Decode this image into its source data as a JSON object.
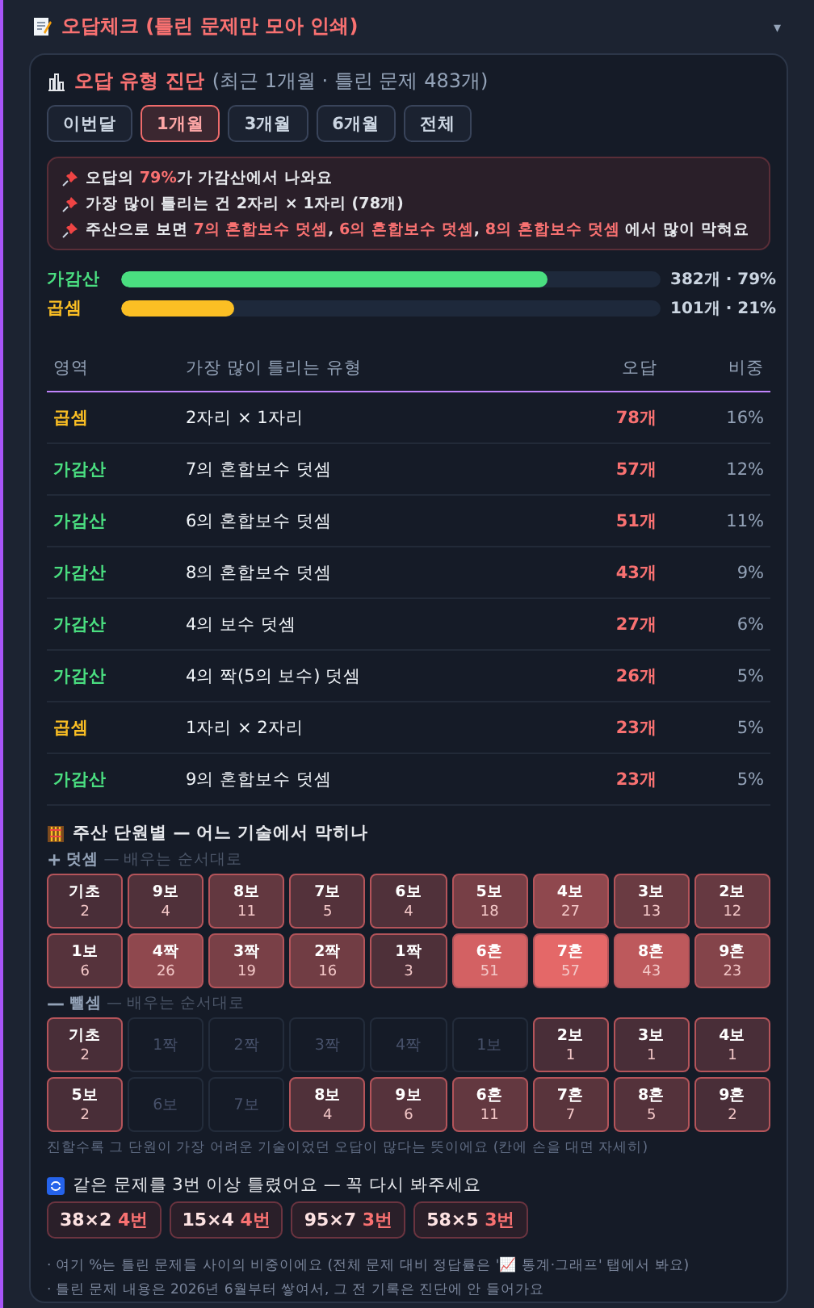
{
  "panel": {
    "title": "오답체크 (틀린 문제만 모아 인쇄)",
    "toggle": "▾"
  },
  "diagnosis": {
    "title": "오답 유형 진단",
    "subtitle": "(최근 1개월 · 틀린 문제 483개)",
    "periods": [
      {
        "label": "이번달",
        "selected": false
      },
      {
        "label": "1개월",
        "selected": true
      },
      {
        "label": "3개월",
        "selected": false
      },
      {
        "label": "6개월",
        "selected": false
      },
      {
        "label": "전체",
        "selected": false
      }
    ],
    "insights": [
      [
        {
          "text": "오답의 ",
          "highlight": false
        },
        {
          "text": "79%",
          "highlight": true
        },
        {
          "text": "가 가감산에서 나와요",
          "highlight": false
        }
      ],
      [
        {
          "text": "가장 많이 틀리는 건 2자리 × 1자리 (78개)",
          "highlight": false
        }
      ],
      [
        {
          "text": "주산으로 보면 ",
          "highlight": false
        },
        {
          "text": "7의 혼합보수 덧셈",
          "highlight": true
        },
        {
          "text": ", ",
          "highlight": false
        },
        {
          "text": "6의 혼합보수 덧셈",
          "highlight": true
        },
        {
          "text": ", ",
          "highlight": false
        },
        {
          "text": "8의 혼합보수 덧셈",
          "highlight": true
        },
        {
          "text": " 에서 많이 막혀요",
          "highlight": false
        }
      ]
    ],
    "bars": [
      {
        "kind": "add",
        "label": "가감산",
        "level": 0.79,
        "reading": "382개 · 79%"
      },
      {
        "kind": "mul",
        "label": "곱셈",
        "level": 0.21,
        "reading": "101개 · 21%"
      }
    ],
    "table": {
      "columns": [
        "영역",
        "가장 많이 틀리는 유형",
        "오답",
        "비중"
      ],
      "rows": [
        {
          "kind": "mul",
          "area": "곱셈",
          "type": "2자리 × 1자리",
          "count": "78개",
          "share": "16%"
        },
        {
          "kind": "add",
          "area": "가감산",
          "type": "7의 혼합보수 덧셈",
          "count": "57개",
          "share": "12%"
        },
        {
          "kind": "add",
          "area": "가감산",
          "type": "6의 혼합보수 덧셈",
          "count": "51개",
          "share": "11%"
        },
        {
          "kind": "add",
          "area": "가감산",
          "type": "8의 혼합보수 덧셈",
          "count": "43개",
          "share": "9%"
        },
        {
          "kind": "add",
          "area": "가감산",
          "type": "4의 보수 덧셈",
          "count": "27개",
          "share": "6%"
        },
        {
          "kind": "add",
          "area": "가감산",
          "type": "4의 짝(5의 보수) 덧셈",
          "count": "26개",
          "share": "5%"
        },
        {
          "kind": "mul",
          "area": "곱셈",
          "type": "1자리 × 2자리",
          "count": "23개",
          "share": "5%"
        },
        {
          "kind": "add",
          "area": "가감산",
          "type": "9의 혼합보수 덧셈",
          "count": "23개",
          "share": "5%"
        }
      ]
    }
  },
  "units": {
    "title": "주산 단원별 — 어느 기술에서 막히나",
    "groups": [
      {
        "sign": "+",
        "name": "덧셈",
        "hint": "— 배우는 순서대로",
        "cells": [
          {
            "label": "기초",
            "count": "2",
            "active": true,
            "color": "#492e38"
          },
          {
            "label": "9보",
            "count": "4",
            "active": true,
            "color": "#50313a"
          },
          {
            "label": "8보",
            "count": "11",
            "active": true,
            "color": "#633840"
          },
          {
            "label": "7보",
            "count": "5",
            "active": true,
            "color": "#54323b"
          },
          {
            "label": "6보",
            "count": "4",
            "active": true,
            "color": "#50313a"
          },
          {
            "label": "5보",
            "count": "18",
            "active": true,
            "color": "#773f46"
          },
          {
            "label": "4보",
            "count": "27",
            "active": true,
            "color": "#8f484e"
          },
          {
            "label": "3보",
            "count": "13",
            "active": true,
            "color": "#6a3b42"
          },
          {
            "label": "2보",
            "count": "12",
            "active": true,
            "color": "#663941"
          },
          {
            "label": "1보",
            "count": "6",
            "active": true,
            "color": "#56333c"
          },
          {
            "label": "4짝",
            "count": "26",
            "active": true,
            "color": "#8f484e"
          },
          {
            "label": "3짝",
            "count": "19",
            "active": true,
            "color": "#794047"
          },
          {
            "label": "2짝",
            "count": "16",
            "active": true,
            "color": "#713d44"
          },
          {
            "label": "1짝",
            "count": "3",
            "active": true,
            "color": "#4e3039"
          },
          {
            "label": "6혼",
            "count": "51",
            "active": true,
            "color": "#d36163"
          },
          {
            "label": "7혼",
            "count": "57",
            "active": true,
            "color": "#e46868"
          },
          {
            "label": "8혼",
            "count": "43",
            "active": true,
            "color": "#bd595c"
          },
          {
            "label": "9혼",
            "count": "23",
            "active": true,
            "color": "#84444a"
          }
        ]
      },
      {
        "sign": "—",
        "name": "뺄셈",
        "hint": "— 배우는 순서대로",
        "cells": [
          {
            "label": "기초",
            "count": "2",
            "active": true,
            "color": "#492e38"
          },
          {
            "label": "1짝",
            "active": false
          },
          {
            "label": "2짝",
            "active": false
          },
          {
            "label": "3짝",
            "active": false
          },
          {
            "label": "4짝",
            "active": false
          },
          {
            "label": "1보",
            "active": false
          },
          {
            "label": "2보",
            "count": "1",
            "active": true,
            "color": "#492e38"
          },
          {
            "label": "3보",
            "count": "1",
            "active": true,
            "color": "#492e38"
          },
          {
            "label": "4보",
            "count": "1",
            "active": true,
            "color": "#492e38"
          },
          {
            "label": "5보",
            "count": "2",
            "active": true,
            "color": "#492e38"
          },
          {
            "label": "6보",
            "active": false
          },
          {
            "label": "7보",
            "active": false
          },
          {
            "label": "8보",
            "count": "4",
            "active": true,
            "color": "#50313a"
          },
          {
            "label": "9보",
            "count": "6",
            "active": true,
            "color": "#56333c"
          },
          {
            "label": "6혼",
            "count": "11",
            "active": true,
            "color": "#633840"
          },
          {
            "label": "7혼",
            "count": "7",
            "active": true,
            "color": "#59343c"
          },
          {
            "label": "8혼",
            "count": "5",
            "active": true,
            "color": "#54323b"
          },
          {
            "label": "9혼",
            "count": "2",
            "active": true,
            "color": "#492e38"
          }
        ]
      }
    ],
    "footnote": "진할수록 그 단원이 가장 어려운 기술이었던 오답이 많다는 뜻이에요 (칸에 손을 대면 자세히)"
  },
  "repeats": {
    "title": "같은 문제를 3번 이상 틀렸어요 — 꼭 다시 봐주세요",
    "items": [
      {
        "problem": "38×2",
        "times": "4번"
      },
      {
        "problem": "15×4",
        "times": "4번"
      },
      {
        "problem": "95×7",
        "times": "3번"
      },
      {
        "problem": "58×5",
        "times": "3번"
      }
    ]
  },
  "notes": [
    "· 여기 %는 틀린 문제들 사이의 비중이에요 (전체 문제 대비 정답률은 '📈 통계·그래프' 탭에서 봐요)",
    "· 틀린 문제 내용은 2026년 6월부터 쌓여서, 그 전 기록은 진단에 안 들어가요"
  ]
}
